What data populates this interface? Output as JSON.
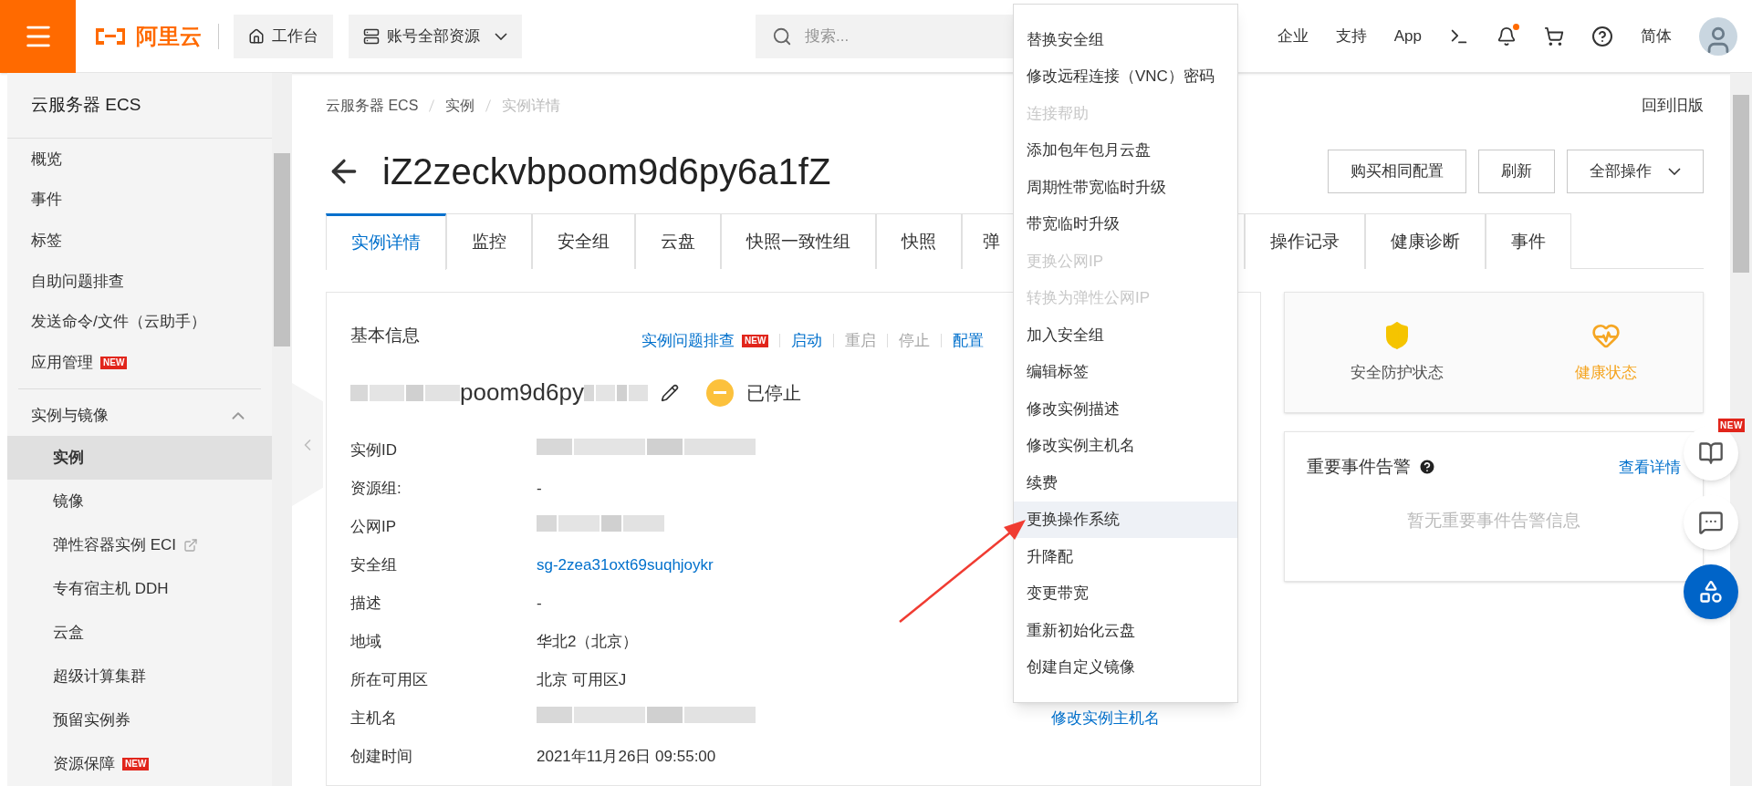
{
  "topbar": {
    "logo": "阿里云",
    "workbench": "工作台",
    "resources": "账号全部资源",
    "search": {
      "placeholder": "搜索..."
    },
    "links": [
      "企业",
      "支持",
      "App"
    ],
    "notification_dot": true,
    "language": "简体"
  },
  "sidebar": {
    "title": "云服务器 ECS",
    "items": [
      {
        "kind": "item",
        "label": "概览",
        "selected": false
      },
      {
        "kind": "item",
        "label": "事件",
        "selected": false
      },
      {
        "kind": "item",
        "label": "标签",
        "selected": false
      },
      {
        "kind": "item",
        "label": "自助问题排查",
        "selected": false
      },
      {
        "kind": "item",
        "label": "发送命令/文件（云助手）",
        "selected": false
      },
      {
        "kind": "item",
        "label": "应用管理",
        "badge": "NEW",
        "selected": false
      },
      {
        "kind": "group",
        "label": "实例与镜像",
        "expanded": true,
        "children": [
          {
            "label": "实例",
            "selected": true
          },
          {
            "label": "镜像",
            "selected": false
          },
          {
            "label": "弹性容器实例 ECI",
            "external": true,
            "selected": false
          },
          {
            "label": "专有宿主机 DDH",
            "selected": false
          },
          {
            "label": "云盒",
            "selected": false
          },
          {
            "label": "超级计算集群",
            "selected": false
          },
          {
            "label": "预留实例券",
            "selected": false
          },
          {
            "label": "资源保障",
            "badge": "NEW",
            "selected": false
          }
        ]
      }
    ]
  },
  "breadcrumb": [
    "云服务器 ECS",
    "实例",
    "实例详情"
  ],
  "back_to_old": "回到旧版",
  "title": "iZ2zeckvbpoom9d6py6a1fZ",
  "header_buttons": [
    {
      "label": "购买相同配置",
      "dropdown": false
    },
    {
      "label": "刷新",
      "dropdown": false
    },
    {
      "label": "全部操作",
      "dropdown": true
    }
  ],
  "tabs": [
    {
      "label": "实例详情",
      "selected": true,
      "covered": false
    },
    {
      "label": "监控",
      "selected": false,
      "covered": false
    },
    {
      "label": "安全组",
      "selected": false,
      "covered": false
    },
    {
      "label": "云盘",
      "selected": false,
      "covered": false
    },
    {
      "label": "快照一致性组",
      "selected": false,
      "covered": false
    },
    {
      "label": "快照",
      "selected": false,
      "covered": false
    },
    {
      "label": "弹",
      "selected": false,
      "covered": true
    },
    {
      "label": "操作记录",
      "selected": false,
      "covered": false
    },
    {
      "label": "健康诊断",
      "selected": false,
      "covered": false
    },
    {
      "label": "事件",
      "selected": false,
      "covered": false
    }
  ],
  "basic_info": {
    "title": "基本信息",
    "actions": [
      {
        "label": "实例问题排查",
        "badge": "NEW",
        "disabled": false
      },
      {
        "label": "启动",
        "disabled": false
      },
      {
        "label": "重启",
        "disabled": true
      },
      {
        "label": "停止",
        "disabled": true
      },
      {
        "label": "配置",
        "disabled": false
      }
    ],
    "name_fragment": "poom9d6py",
    "status": "已停止",
    "fields": [
      {
        "label": "实例ID",
        "kind": "masked"
      },
      {
        "label": "资源组:",
        "kind": "text",
        "value": "-"
      },
      {
        "label": "公网IP",
        "kind": "masked"
      },
      {
        "label": "安全组",
        "kind": "link",
        "value": "sg-2zea31oxt69suqhjoykr"
      },
      {
        "label": "描述",
        "kind": "text",
        "value": "-"
      },
      {
        "label": "地域",
        "kind": "text",
        "value": "华北2（北京）"
      },
      {
        "label": "所在可用区",
        "kind": "text",
        "value": "北京 可用区J"
      },
      {
        "label": "主机名",
        "kind": "masked",
        "action": "修改实例主机名"
      },
      {
        "label": "创建时间",
        "kind": "text",
        "value": "2021年11月26日 09:55:00"
      }
    ]
  },
  "status_card": [
    {
      "label": "安全防护状态",
      "highlighted": false
    },
    {
      "label": "健康状态",
      "highlighted": true
    }
  ],
  "alerts": {
    "title": "重要事件告警",
    "link": "查看详情",
    "empty": "暂无重要事件告警信息"
  },
  "float_badge": "NEW",
  "menu": [
    {
      "label": "替换安全组",
      "disabled": false,
      "selected": false
    },
    {
      "label": "修改远程连接（VNC）密码",
      "disabled": false,
      "selected": false
    },
    {
      "label": "连接帮助",
      "disabled": true,
      "selected": false
    },
    {
      "label": "添加包年包月云盘",
      "disabled": false,
      "selected": false
    },
    {
      "label": "周期性带宽临时升级",
      "disabled": false,
      "selected": false
    },
    {
      "label": "带宽临时升级",
      "disabled": false,
      "selected": false
    },
    {
      "label": "更换公网IP",
      "disabled": true,
      "selected": false
    },
    {
      "label": "转换为弹性公网IP",
      "disabled": true,
      "selected": false
    },
    {
      "label": "加入安全组",
      "disabled": false,
      "selected": false
    },
    {
      "label": "编辑标签",
      "disabled": false,
      "selected": false
    },
    {
      "label": "修改实例描述",
      "disabled": false,
      "selected": false
    },
    {
      "label": "修改实例主机名",
      "disabled": false,
      "selected": false
    },
    {
      "label": "续费",
      "disabled": false,
      "selected": false
    },
    {
      "label": "更换操作系统",
      "disabled": false,
      "selected": true
    },
    {
      "label": "升降配",
      "disabled": false,
      "selected": false
    },
    {
      "label": "变更带宽",
      "disabled": false,
      "selected": false
    },
    {
      "label": "重新初始化云盘",
      "disabled": false,
      "selected": false
    },
    {
      "label": "创建自定义镜像",
      "disabled": false,
      "selected": false
    }
  ]
}
